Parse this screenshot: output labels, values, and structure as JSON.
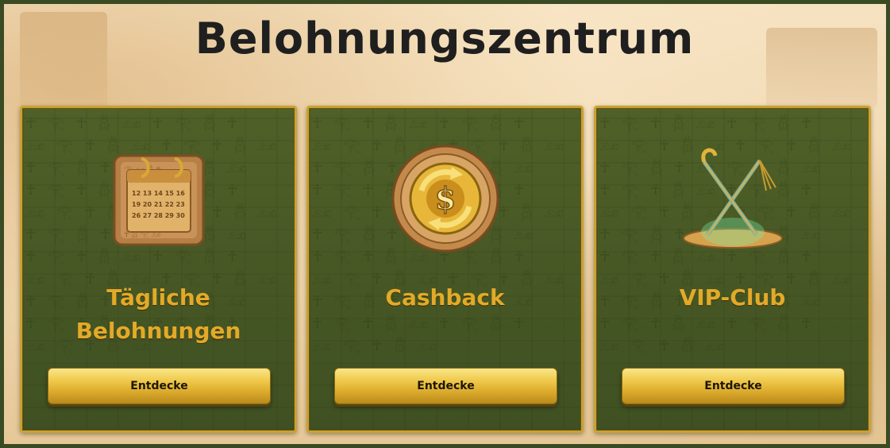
{
  "header": {
    "title": "Belohnungszentrum"
  },
  "cards": [
    {
      "title_line1": "Tägliche",
      "title_line2": "Belohnungen",
      "button_label": "Entdecke",
      "icon": "calendar-tablet-icon"
    },
    {
      "title_line1": "Cashback",
      "button_label": "Entdecke",
      "icon": "gold-dollar-coin-icon"
    },
    {
      "title_line1": "VIP-Club",
      "button_label": "Entdecke",
      "icon": "crook-and-flail-icon"
    }
  ],
  "colors": {
    "card_background": "#4a5b26",
    "card_border": "#c9a230",
    "card_title": "#e2aa28",
    "button_gold": "#f0c94a",
    "title_text": "#1f1f1f",
    "page_background": "#f3dcb6"
  }
}
